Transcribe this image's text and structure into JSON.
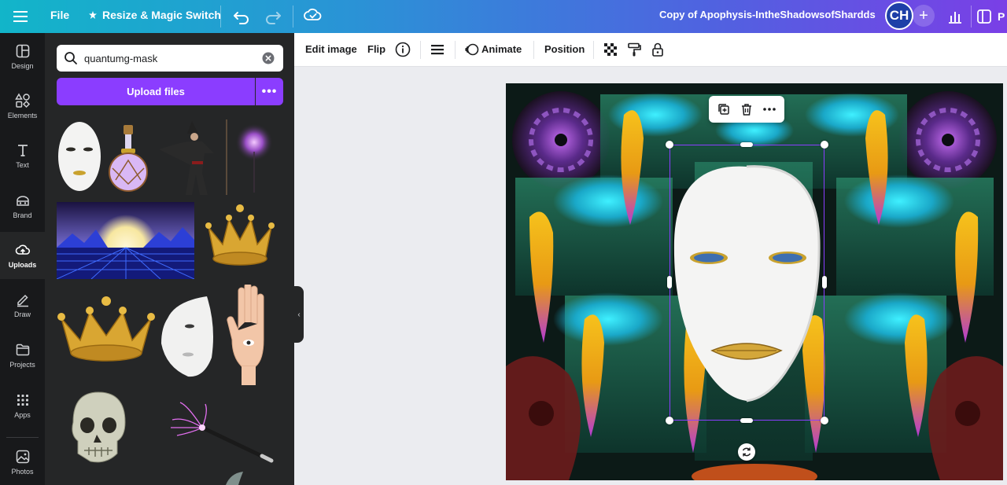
{
  "topbar": {
    "file_label": "File",
    "resize_label": "Resize & Magic Switch",
    "title": "Copy of Apophysis-IntheShadowsofShardds",
    "avatar_initials": "CH",
    "present_label": "P",
    "accent_gradient": [
      "#12b5c9",
      "#7a3fe6"
    ]
  },
  "rail": {
    "items": [
      {
        "label": "Design",
        "icon": "layout-icon"
      },
      {
        "label": "Elements",
        "icon": "shapes-icon"
      },
      {
        "label": "Text",
        "icon": "text-icon"
      },
      {
        "label": "Brand",
        "icon": "brand-icon"
      },
      {
        "label": "Uploads",
        "icon": "cloud-upload-icon",
        "active": true
      },
      {
        "label": "Draw",
        "icon": "pen-icon"
      },
      {
        "label": "Projects",
        "icon": "folder-icon"
      },
      {
        "label": "Apps",
        "icon": "apps-grid-icon"
      },
      {
        "label": "Photos",
        "icon": "photo-icon"
      }
    ]
  },
  "panel": {
    "search_value": "quantumg-mask",
    "upload_label": "Upload files",
    "upload_color": "#8b3dff"
  },
  "toolbar": {
    "edit_image": "Edit image",
    "flip": "Flip",
    "animate": "Animate",
    "position": "Position"
  }
}
